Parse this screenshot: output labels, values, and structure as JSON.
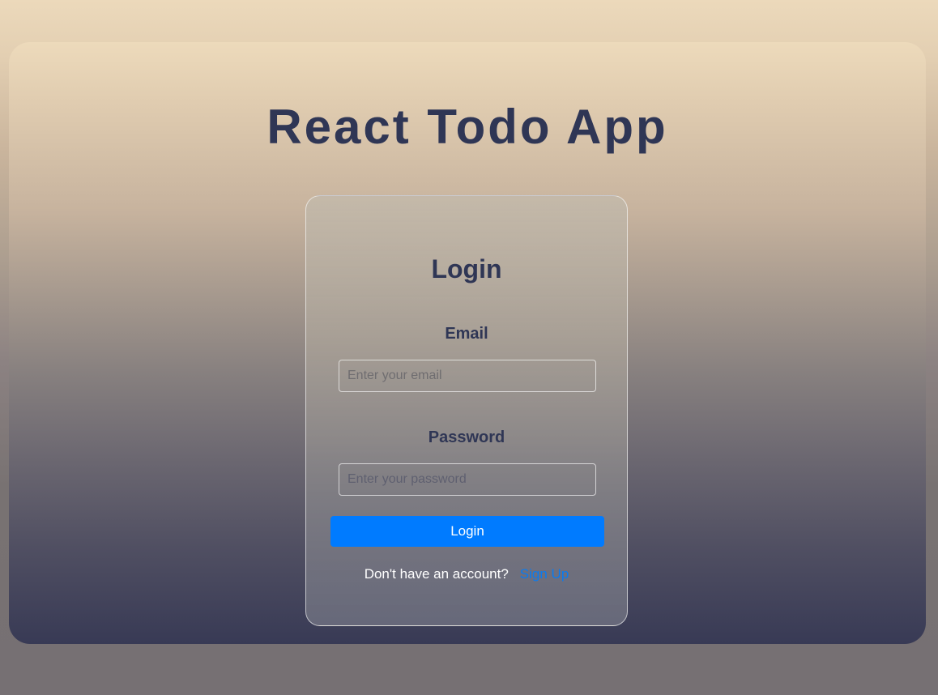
{
  "app": {
    "title": "React Todo App"
  },
  "login_form": {
    "heading": "Login",
    "email": {
      "label": "Email",
      "placeholder": "Enter your email",
      "value": ""
    },
    "password": {
      "label": "Password",
      "placeholder": "Enter your password",
      "value": ""
    },
    "submit_label": "Login",
    "signup_prompt": "Don't have an account?",
    "signup_link": "Sign Up"
  },
  "colors": {
    "accent": "#007bff",
    "title_text": "#2f3655",
    "link": "#0a7bf0"
  }
}
